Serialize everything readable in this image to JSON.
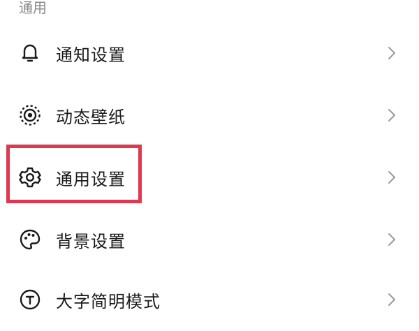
{
  "section": {
    "title": "通用"
  },
  "items": [
    {
      "label": "通知设置",
      "icon": "bell-icon"
    },
    {
      "label": "动态壁纸",
      "icon": "live-wallpaper-icon"
    },
    {
      "label": "通用设置",
      "icon": "gear-icon"
    },
    {
      "label": "背景设置",
      "icon": "palette-icon"
    },
    {
      "label": "大字简明模式",
      "icon": "text-size-icon"
    }
  ],
  "chevron_icon": "chevron-right-icon",
  "colors": {
    "highlight": "#e0384f",
    "header_text": "#8a8a8a",
    "chevron": "#9a9a9a",
    "text": "#1a1a1a"
  }
}
